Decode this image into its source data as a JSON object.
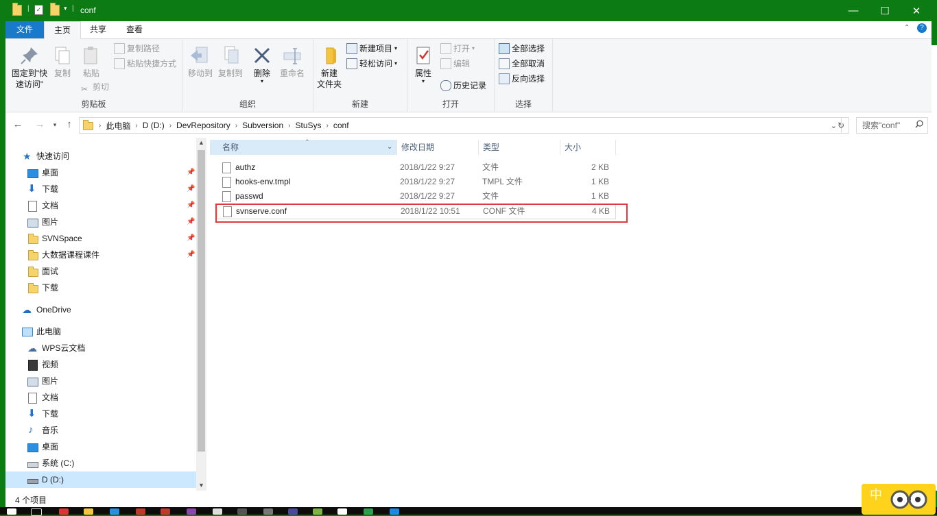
{
  "window": {
    "title": "conf"
  },
  "ribbon_tabs": [
    "文件",
    "主页",
    "共享",
    "查看"
  ],
  "ribbon": {
    "clipboard": {
      "pin": "固定到\"快速访问\"",
      "copy": "复制",
      "paste": "粘贴",
      "copy_path": "复制路径",
      "paste_shortcut": "粘贴快捷方式",
      "cut": "剪切",
      "label": "剪贴板"
    },
    "organize": {
      "move_to": "移动到",
      "copy_to": "复制到",
      "delete": "删除",
      "rename": "重命名",
      "label": "组织"
    },
    "new": {
      "new_folder": "新建\n文件夹",
      "new_item": "新建项目",
      "easy_access": "轻松访问",
      "label": "新建"
    },
    "open": {
      "properties": "属性",
      "open": "打开",
      "edit": "编辑",
      "history": "历史记录",
      "label": "打开"
    },
    "select": {
      "select_all": "全部选择",
      "select_none": "全部取消",
      "invert": "反向选择",
      "label": "选择"
    }
  },
  "address": {
    "crumbs": [
      "此电脑",
      "D (D:)",
      "DevRepository",
      "Subversion",
      "StuSys",
      "conf"
    ],
    "search_placeholder": "搜索\"conf\""
  },
  "nav_pane": {
    "quick_access": "快速访问",
    "quick_items": [
      "桌面",
      "下载",
      "文档",
      "图片",
      "SVNSpace",
      "大数据课程课件",
      "面试",
      "下载"
    ],
    "onedrive": "OneDrive",
    "this_pc": "此电脑",
    "pc_items": [
      "WPS云文档",
      "视频",
      "图片",
      "文档",
      "下载",
      "音乐",
      "桌面",
      "系统 (C:)",
      "D (D:)"
    ]
  },
  "columns": [
    "名称",
    "修改日期",
    "类型",
    "大小"
  ],
  "files": [
    {
      "name": "authz",
      "date": "2018/1/22 9:27",
      "type": "文件",
      "size": "2 KB"
    },
    {
      "name": "hooks-env.tmpl",
      "date": "2018/1/22 9:27",
      "type": "TMPL 文件",
      "size": "1 KB"
    },
    {
      "name": "passwd",
      "date": "2018/1/22 9:27",
      "type": "文件",
      "size": "1 KB"
    },
    {
      "name": "svnserve.conf",
      "date": "2018/1/22 10:51",
      "type": "CONF 文件",
      "size": "4 KB"
    }
  ],
  "status": {
    "count": "4 个项目"
  },
  "ime": {
    "label": "中"
  },
  "colors": {
    "titlebar": "#0c7b13",
    "file_tab": "#1979ca",
    "highlight": "#e0393e",
    "selected": "#cce8ff"
  }
}
